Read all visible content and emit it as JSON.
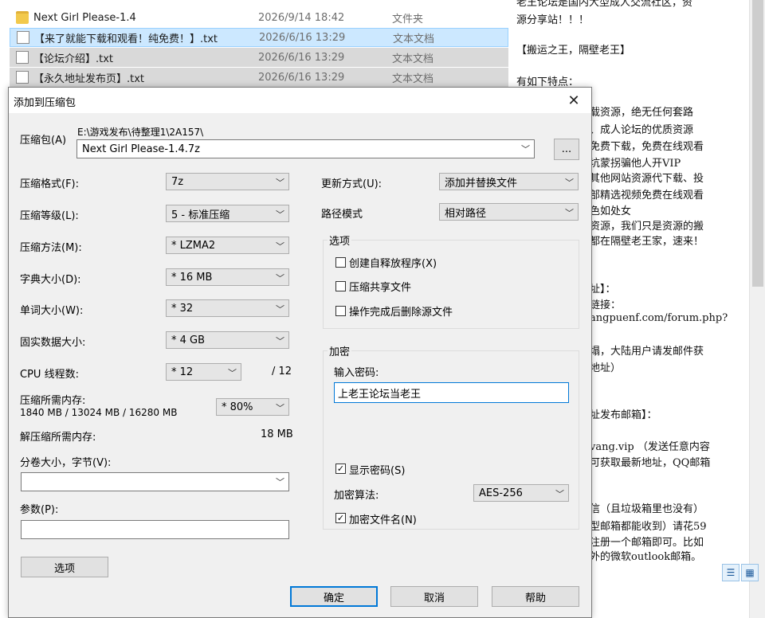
{
  "explorer": {
    "files": [
      {
        "name": "Next Girl Please-1.4",
        "date": "2026/9/14 18:42",
        "type": "文件夹",
        "icon": "folder-icon"
      },
      {
        "name": "【来了就能下载和观看！纯免费！】.txt",
        "date": "2026/6/16 13:29",
        "type": "文本文档",
        "icon": "text-file-icon"
      },
      {
        "name": "【论坛介绍】.txt",
        "date": "2026/6/16 13:29",
        "type": "文本文档",
        "icon": "text-file-icon"
      },
      {
        "name": "【永久地址发布页】.txt",
        "date": "2026/6/16 13:29",
        "type": "文本文档",
        "icon": "text-file-icon"
      }
    ]
  },
  "text_panel": {
    "lines": [
      "老王论坛是国内大型成人交流社区，资",
      "源分享站！！！",
      "【搬运之王，隔壁老王】",
      "有如下特点：",
      "载资源，绝无任何套路",
      "、成人论坛的优质资源",
      "免费下载，免费在线观看",
      "坑蒙拐骗他人开VIP",
      "其他网站资源代下载、投",
      "部精选视频免费在线观看",
      "色如处女",
      "资源，我们只是资源的搬",
      "都在隔壁老王家，速来！",
      "址】：",
      "链接：",
      "angpuenf.com/forum.php?",
      "塌，大陆用户请发邮件获",
      "地址）",
      "址发布邮箱】：",
      "vang.vip  （发送任意内容",
      "可获取最新地址，QQ邮箱",
      "信（且垃圾箱里也没有）",
      "型邮箱都能收到）请花59",
      "注册一个邮箱即可。比如",
      "外的微软outlook邮箱。"
    ]
  },
  "dialog": {
    "title": "添加到压缩包",
    "close": "✕",
    "archive_label": "压缩包(A)",
    "archive_path": "E:\\游戏发布\\待整理1\\2A157\\",
    "archive_name": "Next Girl Please-1.4.7z",
    "browse": "...",
    "format_label": "压缩格式(F):",
    "format_value": "7z",
    "level_label": "压缩等级(L):",
    "level_value": "5 - 标准压缩",
    "method_label": "压缩方法(M):",
    "method_value": "* LZMA2",
    "dict_label": "字典大小(D):",
    "dict_value": "* 16 MB",
    "word_label": "单词大小(W):",
    "word_value": "* 32",
    "solid_label": "固实数据大小:",
    "solid_value": "* 4 GB",
    "cpu_label": "CPU 线程数:",
    "cpu_value": "* 12",
    "cpu_total": "/ 12",
    "mem_label": "压缩所需内存:",
    "mem_values": "1840 MB / 13024 MB / 16280 MB",
    "mem_percent": "* 80%",
    "decomp_label": "解压缩所需内存:",
    "decomp_value": "18 MB",
    "split_label": "分卷大小，字节(V):",
    "split_value": "",
    "params_label": "参数(P):",
    "params_value": "",
    "options_button": "选项",
    "update_label": "更新方式(U):",
    "update_value": "添加并替换文件",
    "pathmode_label": "路径模式",
    "pathmode_value": "相对路径",
    "options_group": "选项",
    "opt_sfx": "创建自释放程序(X)",
    "opt_shared": "压缩共享文件",
    "opt_delete": "操作完成后删除源文件",
    "encrypt_group": "加密",
    "password_label": "输入密码:",
    "password_value": "上老王论坛当老王",
    "show_password": "显示密码(S)",
    "algo_label": "加密算法:",
    "algo_value": "AES-256",
    "encrypt_names": "加密文件名(N)",
    "ok": "确定",
    "cancel": "取消",
    "help": "帮助",
    "checked_glyph": "✓"
  }
}
